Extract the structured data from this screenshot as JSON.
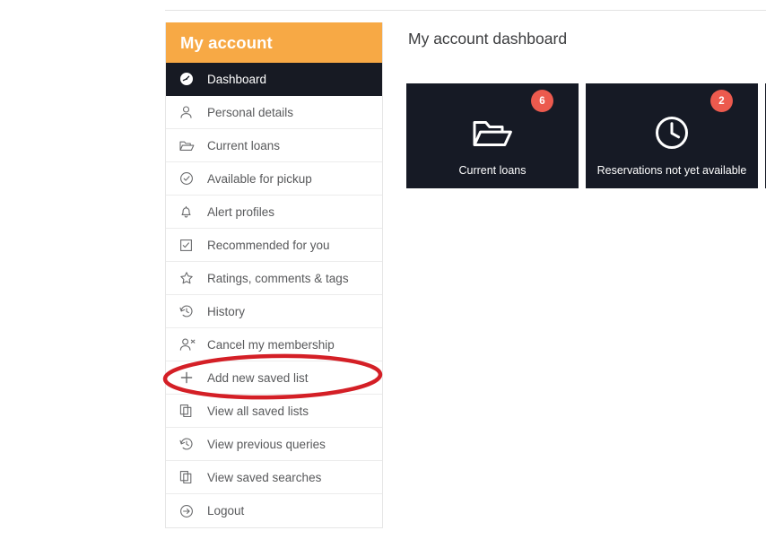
{
  "sidebar": {
    "header_title": "My account",
    "header_bg": "#f7a945",
    "active_bg": "#171a23",
    "items": [
      {
        "label": "Dashboard",
        "icon": "gauge-icon",
        "active": true
      },
      {
        "label": "Personal details",
        "icon": "person-icon",
        "active": false
      },
      {
        "label": "Current loans",
        "icon": "open-folder-icon",
        "active": false
      },
      {
        "label": "Available for pickup",
        "icon": "check-circle-icon",
        "active": false
      },
      {
        "label": "Alert profiles",
        "icon": "bell-icon",
        "active": false
      },
      {
        "label": "Recommended for you",
        "icon": "checkbox-icon",
        "active": false
      },
      {
        "label": "Ratings, comments & tags",
        "icon": "star-icon",
        "active": false
      },
      {
        "label": "History",
        "icon": "history-icon",
        "active": false
      },
      {
        "label": "Cancel my membership",
        "icon": "person-remove-icon",
        "active": false
      },
      {
        "label": "Add new saved list",
        "icon": "plus-icon",
        "active": false
      },
      {
        "label": "View all saved lists",
        "icon": "copy-icon",
        "active": false
      },
      {
        "label": "View previous queries",
        "icon": "history-icon",
        "active": false
      },
      {
        "label": "View saved searches",
        "icon": "copy-icon",
        "active": false
      },
      {
        "label": "Logout",
        "icon": "arrow-right-circle-icon",
        "active": false
      }
    ]
  },
  "main": {
    "page_title": "My account dashboard",
    "tile_bg": "#161a25",
    "badge_color": "#ec5a4e",
    "tiles": [
      {
        "label": "Current loans",
        "badge": "6",
        "icon": "open-folder-icon"
      },
      {
        "label": "Reservations not yet available",
        "badge": "2",
        "icon": "clock-icon"
      }
    ]
  },
  "annotation": {
    "shape": "ellipse",
    "color": "#d41f26",
    "targets": "Add new saved list"
  }
}
